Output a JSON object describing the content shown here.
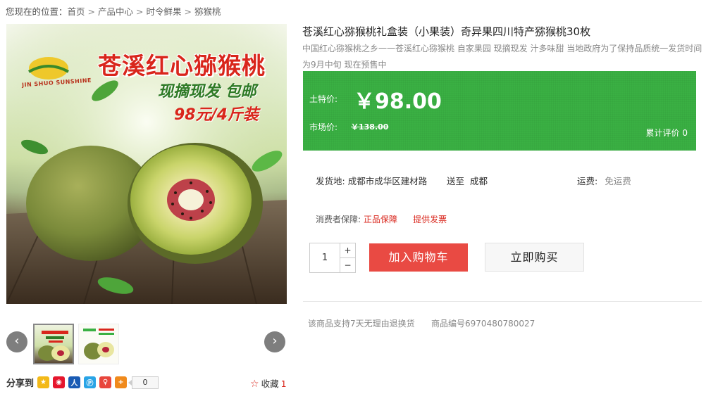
{
  "breadcrumb": {
    "prefix": "您现在的位置：",
    "items": [
      "首页",
      "产品中心",
      "时令鲜果",
      "猕猴桃"
    ],
    "separator": ">"
  },
  "gallery": {
    "logo_text": "JIN SHUO SUNSHINE",
    "promo_title": "苍溪红心猕猴桃",
    "promo_subtitle": "现摘现发  包邮",
    "promo_price": "98元/4斤装",
    "prev_arrow": "‹",
    "next_arrow": "›",
    "thumbnails": [
      "thumb-1",
      "thumb-2"
    ]
  },
  "share": {
    "label": "分享到",
    "icons": [
      "qzone-icon",
      "weibo-icon",
      "renren-icon",
      "qq-icon",
      "tencent-weibo-icon",
      "more-share-icon"
    ],
    "count": "0",
    "collect_label": "收藏",
    "collect_count": "1"
  },
  "product": {
    "title": "苍溪红心猕猴桃礼盒装（小果装）奇异果四川特产猕猴桃30枚",
    "description": "中国红心猕猴桃之乡一一苍溪红心猕猴桃  自家果园  现摘现发  汁多味甜  当地政府为了保持品质统一发货时间为9月中旬  现在预售中"
  },
  "price": {
    "tuteprice_label": "土特价:",
    "tuteprice": "￥98.00",
    "market_label": "市场价:",
    "market_price": "￥138.00",
    "reviews_label": "累计评价",
    "reviews_count": "0"
  },
  "shipping": {
    "from_label": "发货地:",
    "from_value": "成都市成华区建材路",
    "to_label": "送至",
    "to_value": "成都",
    "freight_label": "运费:",
    "freight_value": "免运费"
  },
  "guarantee": {
    "label": "消费者保障:",
    "items": [
      "正品保障",
      "提供发票"
    ]
  },
  "purchase": {
    "quantity": "1",
    "plus": "+",
    "minus": "−",
    "add_to_cart": "加入购物车",
    "buy_now": "立即购买"
  },
  "footer": {
    "return_policy": "该商品支持7天无理由退换货",
    "sku_label": "商品编号",
    "sku": "6970480780027"
  },
  "colors": {
    "price_panel": "#3ab043",
    "cart_button": "#e94a43",
    "accent_red": "#d9261c"
  }
}
